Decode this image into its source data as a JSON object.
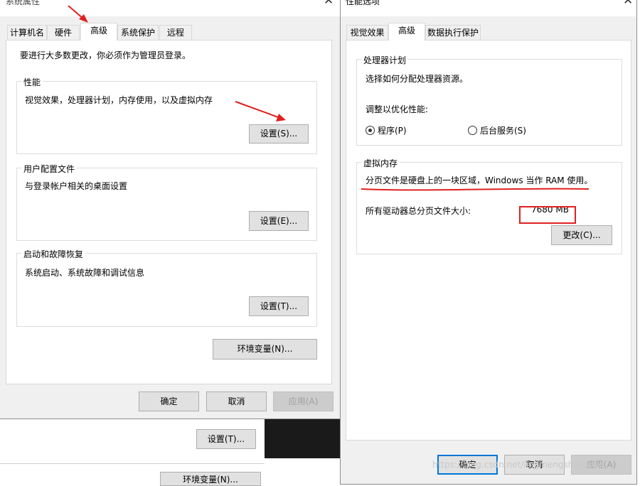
{
  "background": {
    "btn_settings": "设置(T)...",
    "btn_env": "环境变量(N)..."
  },
  "system_properties": {
    "title": "系统属性",
    "tabs": [
      "计算机名",
      "硬件",
      "高级",
      "系统保护",
      "远程"
    ],
    "admin_note": "要进行大多数更改，你必须作为管理员登录。",
    "performance": {
      "title": "性能",
      "desc": "视觉效果，处理器计划，内存使用，以及虚拟内存",
      "button": "设置(S)..."
    },
    "user_profiles": {
      "title": "用户配置文件",
      "desc": "与登录帐户相关的桌面设置",
      "button": "设置(E)..."
    },
    "startup_recovery": {
      "title": "启动和故障恢复",
      "desc": "系统启动、系统故障和调试信息",
      "button": "设置(T)..."
    },
    "env_button": "环境变量(N)...",
    "ok": "确定",
    "cancel": "取消",
    "apply": "应用(A)"
  },
  "performance_options": {
    "title": "性能选项",
    "tabs": [
      "视觉效果",
      "高级",
      "数据执行保护"
    ],
    "processor": {
      "title": "处理器计划",
      "desc": "选择如何分配处理器资源。",
      "adjust": "调整以优化性能:",
      "opt_programs": "程序(P)",
      "opt_services": "后台服务(S)",
      "selected": "程序(P)"
    },
    "virtual_memory": {
      "title": "虚拟内存",
      "desc": "分页文件是硬盘上的一块区域，Windows 当作 RAM 使用。",
      "size_label": "所有驱动器总分页文件大小:",
      "size_value": "7680 MB",
      "change_button": "更改(C)..."
    },
    "ok": "确定",
    "cancel": "取消",
    "apply": "应用(A)"
  },
  "watermark": "https://blog.csdn.net/lingmengshuxiawo",
  "colors": {
    "annotation": "#e02020",
    "focus": "#0078d7"
  }
}
